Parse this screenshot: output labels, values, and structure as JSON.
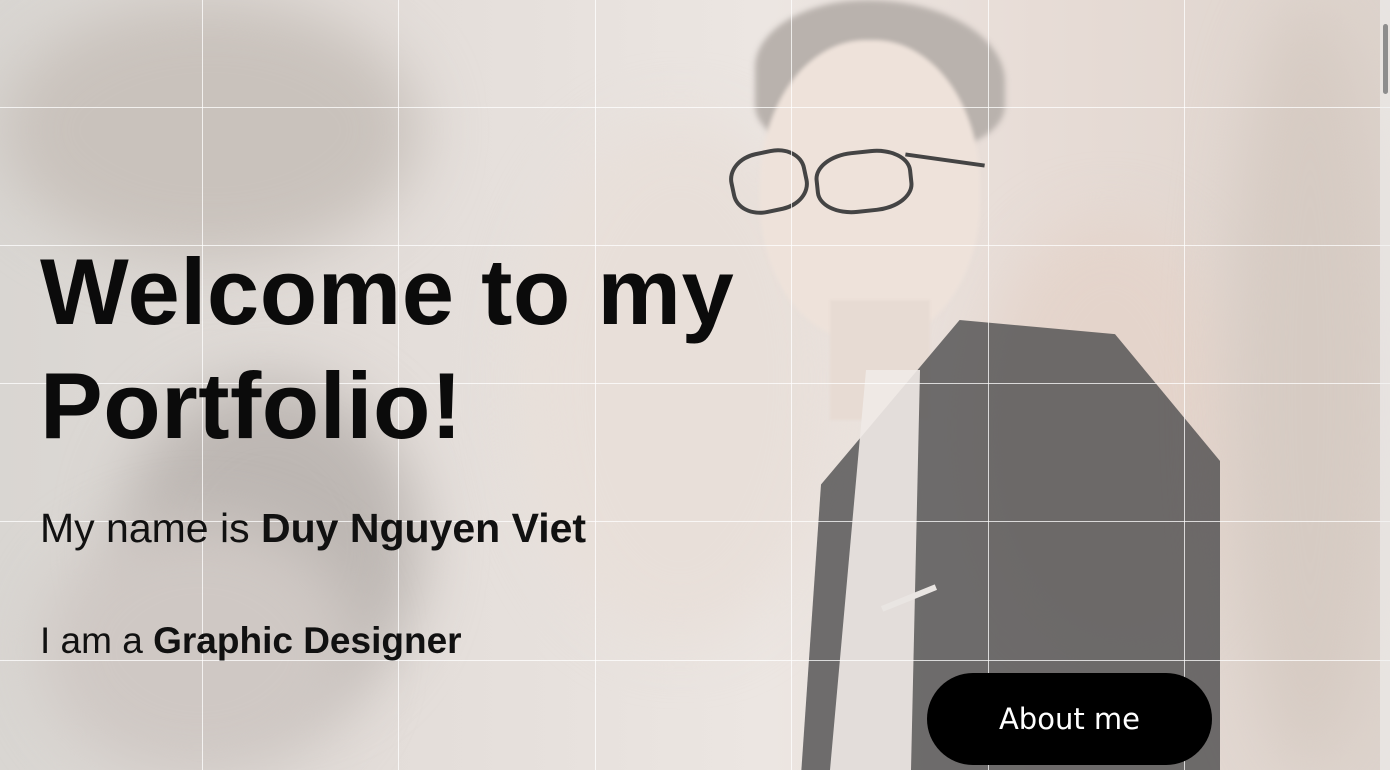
{
  "hero": {
    "title": "Welcome to my Portfolio!",
    "name_prefix": "My name is ",
    "name": "Duy Nguyen Viet",
    "role_prefix": "I am a ",
    "role": "Graphic Designer"
  },
  "cta": {
    "about_label": "About me"
  },
  "colors": {
    "text": "#0b0b0b",
    "button_bg": "#000000",
    "button_text": "#ffffff",
    "grid_line": "#ffffff"
  }
}
